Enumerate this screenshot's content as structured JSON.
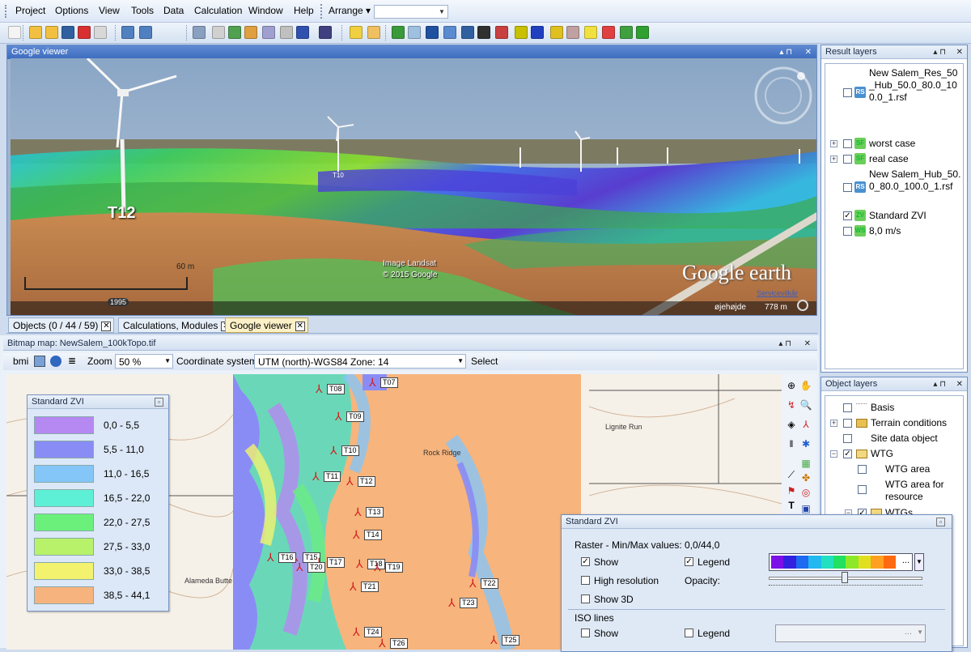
{
  "menu": [
    "Project",
    "Options",
    "View",
    "Tools",
    "Data",
    "Calculation",
    "Window",
    "Help"
  ],
  "arrange_label": "Arrange",
  "google_viewer": {
    "title": "Google viewer",
    "turbine_big": "T12",
    "turbine_small": "T10",
    "scale_label": "60 m",
    "year": "1995",
    "imagery_line1": "Image Landsat",
    "imagery_line2": "© 2015 Google",
    "logo_text": "Google earth",
    "logo_sub": "Servicevilkår",
    "eye_label": "øjehøjde",
    "eye_value": "778 m"
  },
  "tabs": [
    {
      "label": "Objects (0 / 44 / 59)"
    },
    {
      "label": "Calculations, Modules"
    },
    {
      "label": "Google viewer"
    }
  ],
  "bitmap": {
    "title": "Bitmap map: NewSalem_100kTopo.tif",
    "bmi_label": "bmi",
    "zoom_label": "Zoom",
    "zoom_value": "50 %",
    "coord_label": "Coordinate system",
    "coord_value": "UTM (north)-WGS84 Zone: 14",
    "select_label": "Select",
    "map_places": [
      "Alameda Butte",
      "Lignite Run",
      "Rock Ridge"
    ]
  },
  "turbines": [
    "T07",
    "T08",
    "T09",
    "T10",
    "T11",
    "T12",
    "T13",
    "T14",
    "T15",
    "T16",
    "T17",
    "T18",
    "T19",
    "T20",
    "T21",
    "T22",
    "T23",
    "T24",
    "T25",
    "T26"
  ],
  "result_layers": {
    "title": "Result layers",
    "items": [
      {
        "label": "New Salem_Res_50_Hub_50.0_80.0_100.0_1.rsf",
        "checked": false,
        "icon": "rsf"
      },
      {
        "label": "worst case",
        "checked": false,
        "icon": "sf"
      },
      {
        "label": "real case",
        "checked": false,
        "icon": "sf"
      },
      {
        "label": "New Salem_Hub_50.0_80.0_100.0_1.rsf",
        "checked": false,
        "icon": "rsf"
      },
      {
        "label": "Standard ZVI",
        "checked": true,
        "icon": "zvi"
      },
      {
        "label": "8,0 m/s",
        "checked": false,
        "icon": "ws"
      }
    ]
  },
  "object_layers": {
    "title": "Object layers",
    "items": [
      {
        "label": "Basis"
      },
      {
        "label": "Terrain conditions"
      },
      {
        "label": "Site data object"
      },
      {
        "label": "WTG"
      },
      {
        "label": "WTG area"
      },
      {
        "label": "WTG area for resource"
      },
      {
        "label": "WTGs"
      }
    ]
  },
  "legend": {
    "title": "Standard ZVI",
    "rows": [
      {
        "range": "0,0 - 5,5",
        "color": "#b688f2"
      },
      {
        "range": "5,5 - 11,0",
        "color": "#8a8cf5"
      },
      {
        "range": "11,0 - 16,5",
        "color": "#85c6f8"
      },
      {
        "range": "16,5 - 22,0",
        "color": "#5ef0d6"
      },
      {
        "range": "22,0 - 27,5",
        "color": "#6cf07c"
      },
      {
        "range": "27,5 - 33,0",
        "color": "#b8f26a"
      },
      {
        "range": "33,0 - 38,5",
        "color": "#f2f26e"
      },
      {
        "range": "38,5 - 44,1",
        "color": "#f7b37e"
      }
    ]
  },
  "dialog": {
    "title": "Standard ZVI",
    "raster_label": "Raster - Min/Max values: 0,0/44,0",
    "show": "Show",
    "legend": "Legend",
    "high_res": "High resolution",
    "opacity": "Opacity:",
    "show3d": "Show 3D",
    "iso_title": "ISO lines",
    "iso_show": "Show",
    "iso_legend": "Legend",
    "ellipsis": "..."
  },
  "colors": {
    "gradient": [
      "#7b10e8",
      "#3222e0",
      "#1e6af0",
      "#22b8f0",
      "#22e0c0",
      "#22e060",
      "#8ee82a",
      "#e0e020",
      "#ffa020",
      "#ff6a10"
    ]
  }
}
